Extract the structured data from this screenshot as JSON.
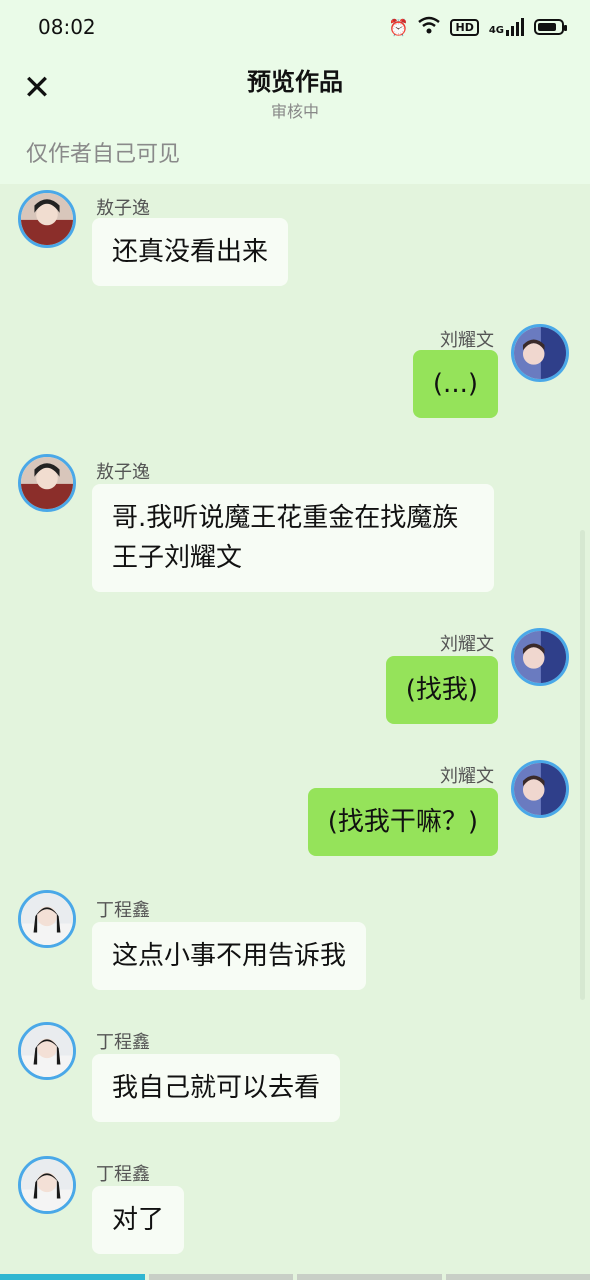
{
  "status_bar": {
    "time": "08:02",
    "icons": [
      "alarm-icon",
      "wifi-icon",
      "hd-icon",
      "4g-signal-icon",
      "battery-icon"
    ],
    "hd_label": "HD",
    "network_label": "4G"
  },
  "header": {
    "close_label": "✕",
    "title": "预览作品",
    "subtitle": "审核中"
  },
  "visibility_note": "仅作者自己可见",
  "messages": [
    {
      "side": "left",
      "name": "敖子逸",
      "text": "还真没看出来"
    },
    {
      "side": "right",
      "name": "刘耀文",
      "text": "(...)"
    },
    {
      "side": "left",
      "name": "敖子逸",
      "text": "哥.我听说魔王花重金在找魔族王子刘耀文"
    },
    {
      "side": "right",
      "name": "刘耀文",
      "text": "(找我)"
    },
    {
      "side": "right",
      "name": "刘耀文",
      "text": "(找我干嘛？)"
    },
    {
      "side": "left",
      "name": "丁程鑫",
      "text": "这点小事不用告诉我"
    },
    {
      "side": "left",
      "name": "丁程鑫",
      "text": "我自己就可以去看"
    },
    {
      "side": "left",
      "name": "丁程鑫",
      "text": "对了"
    }
  ],
  "colors": {
    "background": "#e3f4dd",
    "right_bubble": "#95e35a",
    "left_bubble": "#f7fcf5",
    "avatar_ring": "#4aa8e8",
    "progress_active": "#2fb6d1"
  }
}
